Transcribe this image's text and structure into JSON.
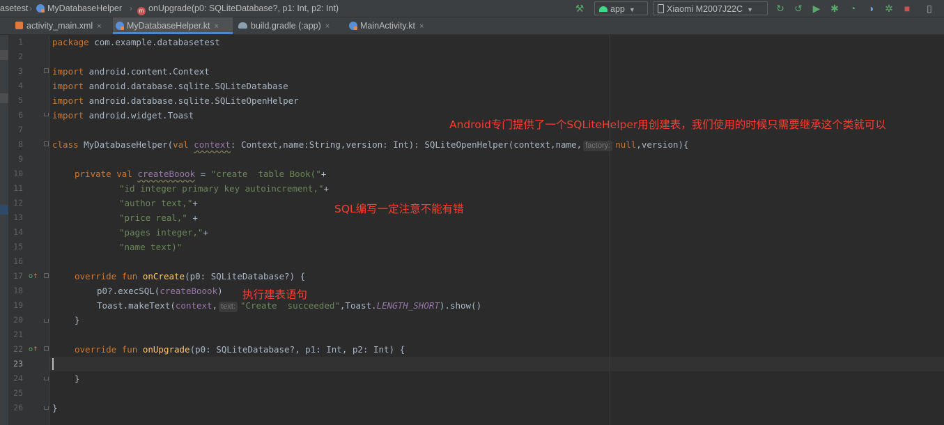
{
  "navbar": {
    "breadcrumbs": [
      "asetest",
      "MyDatabaseHelper",
      "onUpgrade(p0: SQLiteDatabase?, p1: Int, p2: Int)"
    ],
    "run_config": "app",
    "device": "Xiaomi M2007J22C",
    "toolbar_icons": [
      "build-hammer-icon",
      "apply-changes-icon",
      "apply-code-changes-icon",
      "run-icon",
      "debug-icon",
      "profile-icon",
      "attach-debugger-icon",
      "stop-icon",
      "device-manager-icon"
    ]
  },
  "tabs": [
    {
      "label": "activity_main.xml",
      "icon": "xml-file-icon",
      "active": false
    },
    {
      "label": "MyDatabaseHelper.kt",
      "icon": "kotlin-file-icon",
      "active": true
    },
    {
      "label": "build.gradle (:app)",
      "icon": "gradle-icon",
      "active": false
    },
    {
      "label": "MainActivity.kt",
      "icon": "kotlin-file-icon",
      "active": false
    }
  ],
  "tab_close_glyph": "×",
  "editor": {
    "line_numbers": [
      "1",
      "2",
      "3",
      "4",
      "5",
      "6",
      "7",
      "8",
      "9",
      "10",
      "11",
      "12",
      "13",
      "14",
      "15",
      "16",
      "17",
      "18",
      "19",
      "20",
      "21",
      "22",
      "23",
      "24",
      "25",
      "26"
    ],
    "current_line": "23",
    "code": {
      "l1": [
        "package",
        " com.example.databasetest"
      ],
      "l3": [
        "import",
        " android.content.Context"
      ],
      "l4": [
        "import",
        " android.database.sqlite.SQLiteDatabase"
      ],
      "l5": [
        "import",
        " android.database.sqlite.SQLiteOpenHelper"
      ],
      "l6": [
        "import",
        " android.widget.Toast"
      ],
      "l8": [
        "class ",
        "MyDatabaseHelper(",
        "val ",
        "context",
        ": Context,name:String,version: Int): SQLiteOpenHelper(context,name,",
        "factory:",
        "null",
        ",version){"
      ],
      "l10": [
        "private val ",
        "createBoook",
        " = ",
        "\"create  table Book(\"",
        "+"
      ],
      "l11": [
        "\"id integer primary key autoincrement,\"",
        "+"
      ],
      "l12": [
        "\"author text,\"",
        "+"
      ],
      "l13": [
        "\"price real,\"",
        " +"
      ],
      "l14": [
        "\"pages integer,\"",
        "+"
      ],
      "l15": [
        "\"name text)\""
      ],
      "l17": [
        "override fun ",
        "onCreate",
        "(p0: SQLiteDatabase?) {"
      ],
      "l18": [
        "p0?.execSQL(",
        "createBoook",
        ")"
      ],
      "l19": [
        "Toast.makeText(",
        "context",
        ",",
        "text:",
        "\"Create  succeeded\"",
        ",Toast.",
        "LENGTH_SHORT",
        ").show()"
      ],
      "l20": [
        "}"
      ],
      "l22": [
        "override fun ",
        "onUpgrade",
        "(p0: SQLiteDatabase?, p1: Int, p2: Int) {"
      ],
      "l24": [
        "}"
      ],
      "l26": [
        "}"
      ]
    }
  },
  "annotations": {
    "helper_note": "Android专门提供了一个SQLiteHelper用创建表，我们使用的时候只需要继承这个类就可以",
    "sql_note": "SQL编写一定注意不能有错",
    "exec_note": "执行建表语句"
  },
  "colors": {
    "keyword": "#cc7832",
    "string": "#6a8759",
    "property": "#9876aa",
    "function": "#ffc66d",
    "annotation_red": "#ff3b30",
    "editor_bg": "#2b2b2b"
  }
}
